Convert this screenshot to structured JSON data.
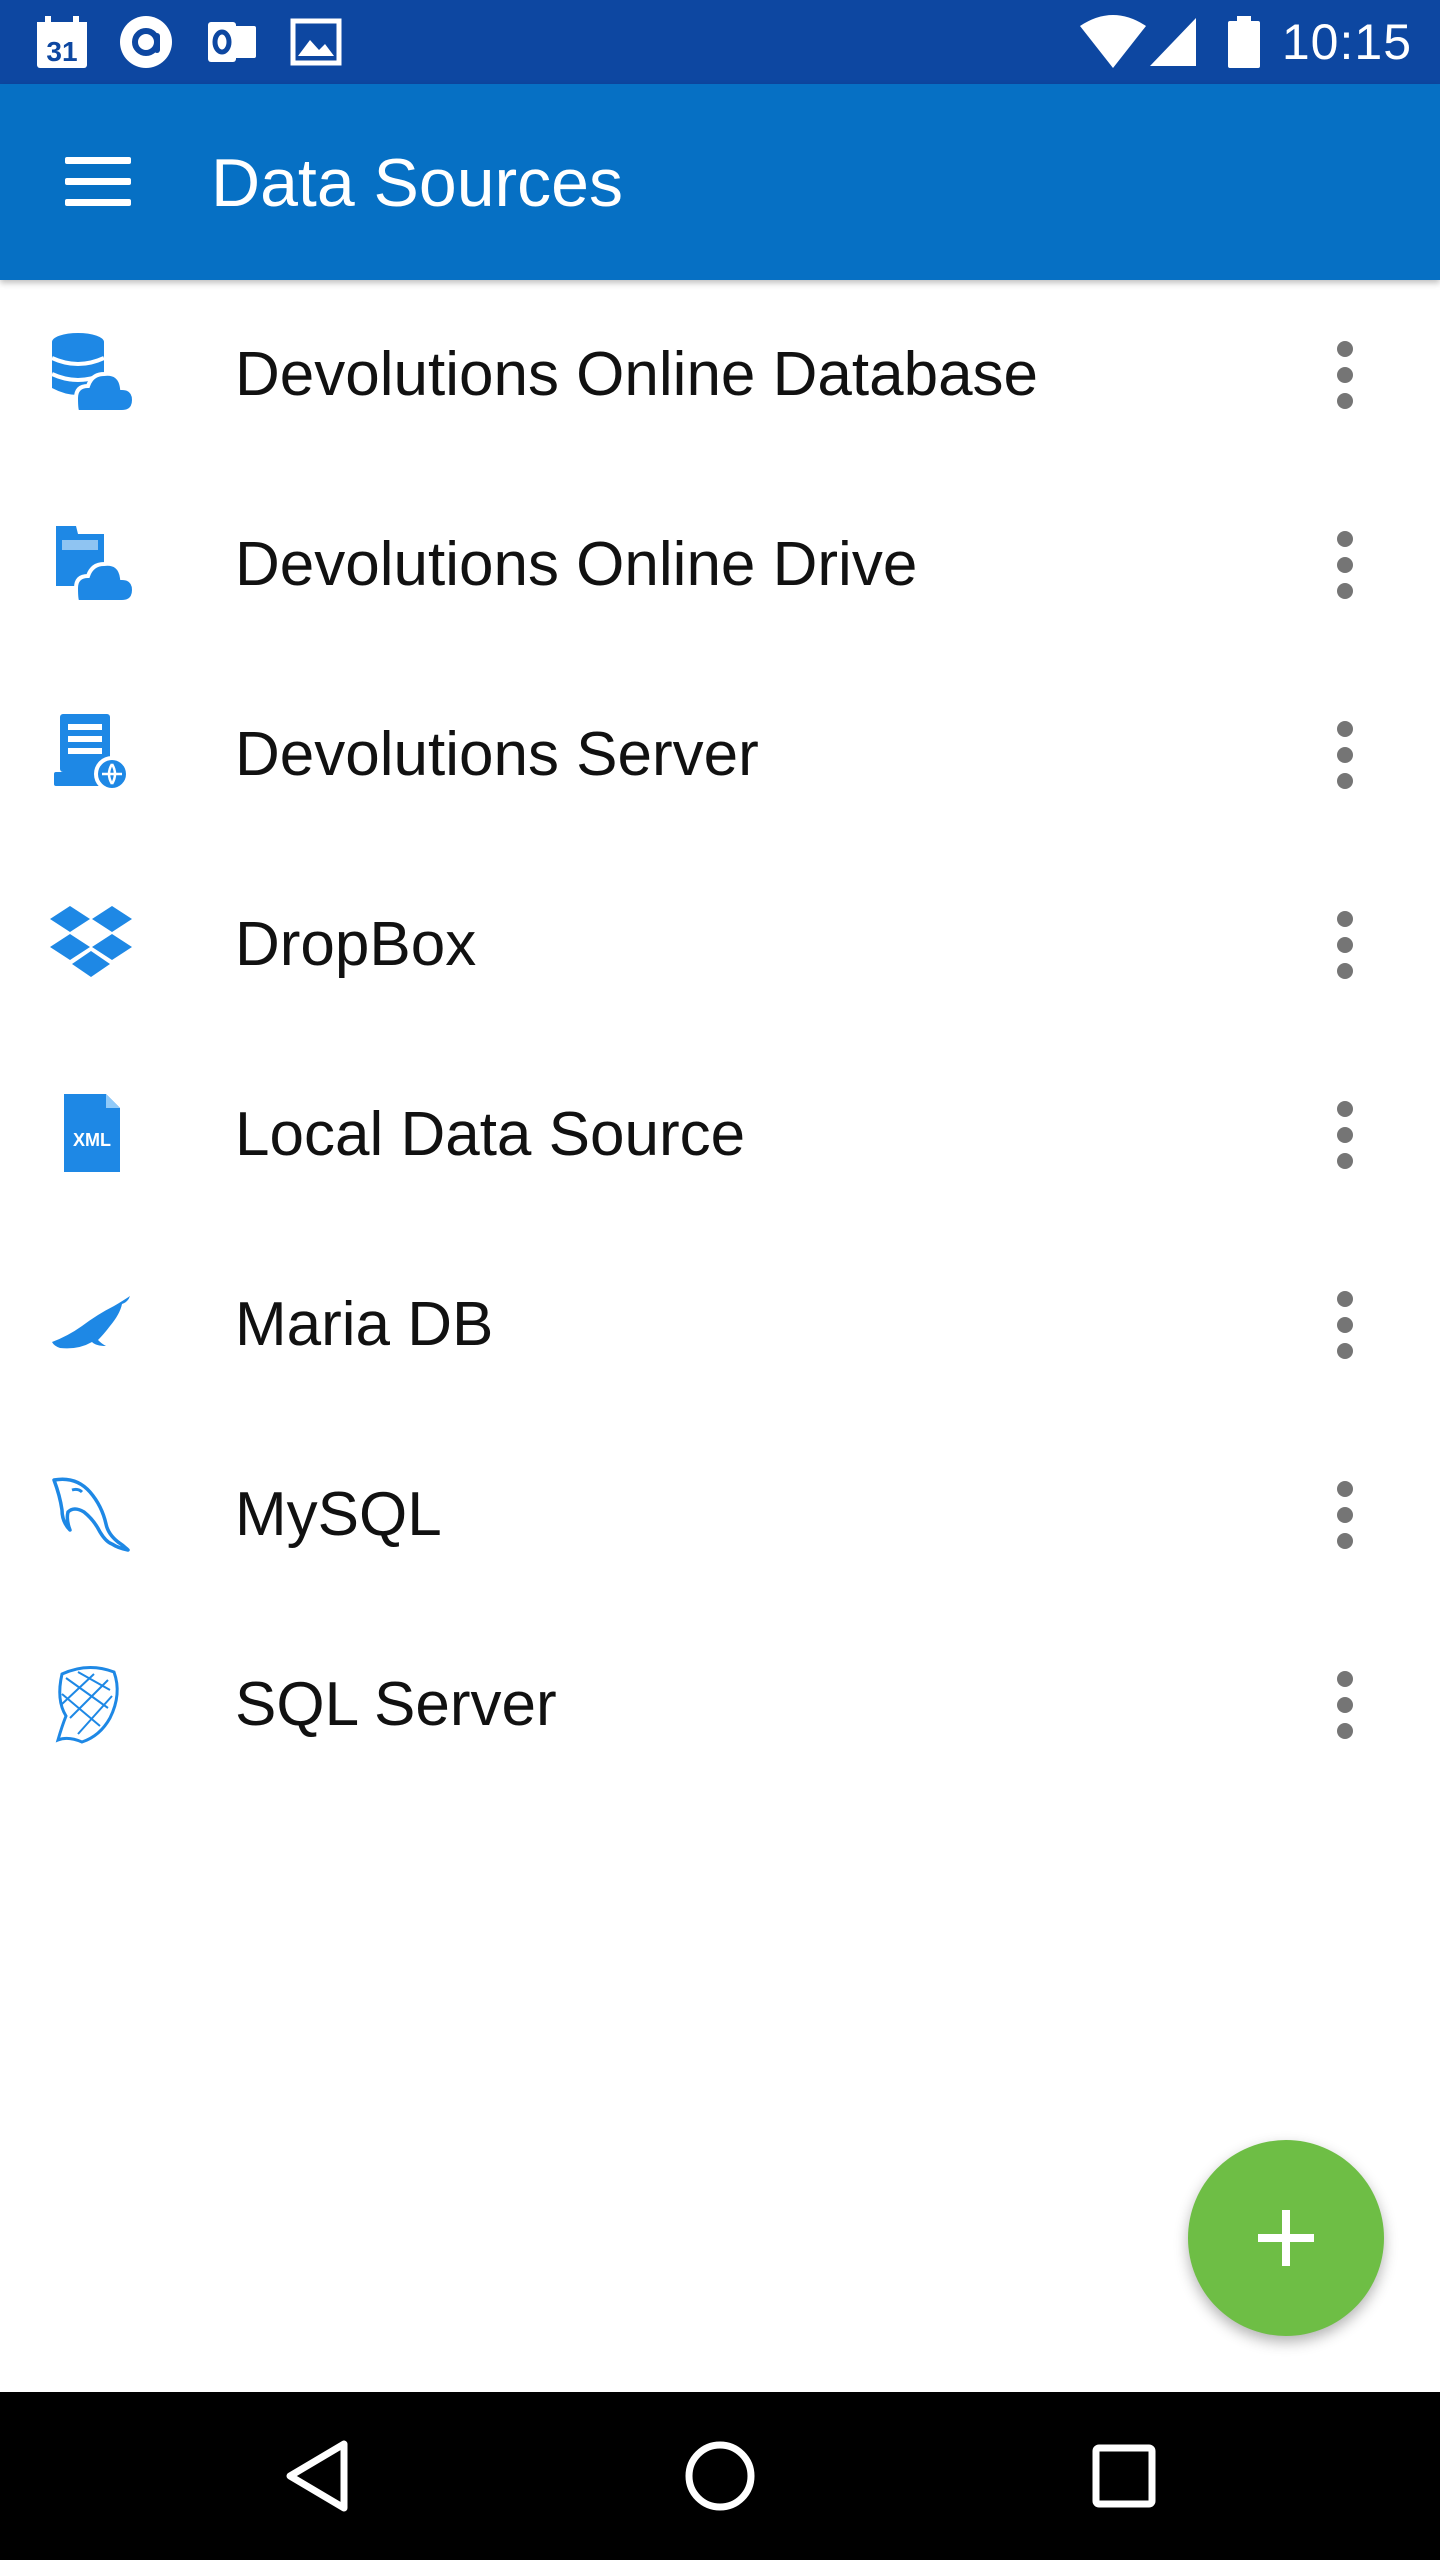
{
  "status_bar": {
    "time": "10:15",
    "calendar_date": "31",
    "icons": [
      "calendar-icon",
      "at-sign-icon",
      "outlook-icon",
      "image-icon",
      "wifi-icon",
      "signal-icon",
      "battery-icon"
    ]
  },
  "app_bar": {
    "title": "Data Sources"
  },
  "data_sources": [
    {
      "label": "Devolutions Online Database",
      "icon": "cloud-database-icon"
    },
    {
      "label": "Devolutions Online Drive",
      "icon": "cloud-drive-icon"
    },
    {
      "label": "Devolutions Server",
      "icon": "server-icon"
    },
    {
      "label": "DropBox",
      "icon": "dropbox-icon"
    },
    {
      "label": "Local Data Source",
      "icon": "xml-file-icon"
    },
    {
      "label": "Maria DB",
      "icon": "mariadb-seal-icon"
    },
    {
      "label": "MySQL",
      "icon": "mysql-dolphin-icon"
    },
    {
      "label": "SQL Server",
      "icon": "sql-server-icon"
    }
  ],
  "xml_label": "XML",
  "colors": {
    "status_bar": "#0d47a1",
    "app_bar": "#0670c4",
    "icon_blue": "#1e88e5",
    "fab": "#6ebe45",
    "more_dots": "#757575",
    "nav_bar": "#000000"
  }
}
